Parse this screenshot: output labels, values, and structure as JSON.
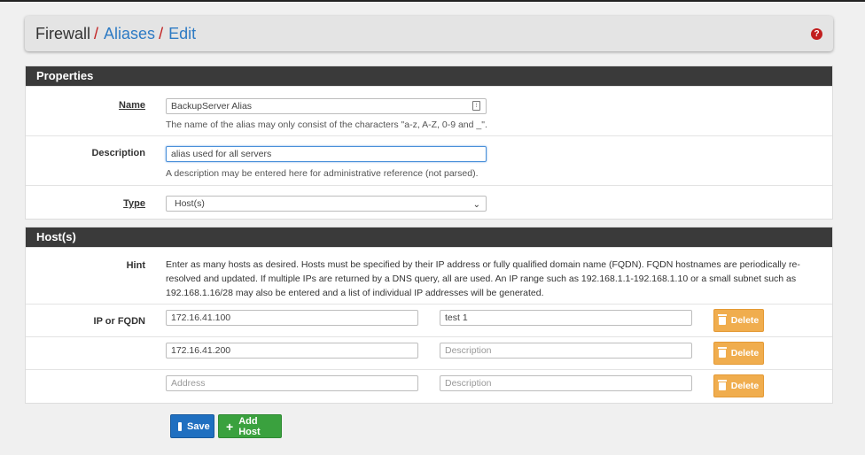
{
  "breadcrumb": {
    "root": "Firewall",
    "sep": "/",
    "aliases": "Aliases",
    "edit": "Edit"
  },
  "help_icon": "question-circle-icon",
  "properties": {
    "title": "Properties",
    "name": {
      "label": "Name",
      "value": "BackupServer Alias",
      "help": "The name of the alias may only consist of the characters \"a-z, A-Z, 0-9 and _\"."
    },
    "description": {
      "label": "Description",
      "value": "alias used for all servers",
      "help": "A description may be entered here for administrative reference (not parsed)."
    },
    "type": {
      "label": "Type",
      "value": "Host(s)"
    }
  },
  "hosts": {
    "title": "Host(s)",
    "hint_label": "Hint",
    "hint_text": "Enter as many hosts as desired. Hosts must be specified by their IP address or fully qualified domain name (FQDN). FQDN hostnames are periodically re-resolved and updated. If multiple IPs are returned by a DNS query, all are used. An IP range such as 192.168.1.1-192.168.1.10 or a small subnet such as 192.168.1.16/28 may also be entered and a list of individual IP addresses will be generated.",
    "ip_label": "IP or FQDN",
    "address_placeholder": "Address",
    "description_placeholder": "Description",
    "delete_label": "Delete",
    "rows": [
      {
        "address": "172.16.41.100",
        "description": "test 1"
      },
      {
        "address": "172.16.41.200",
        "description": ""
      },
      {
        "address": "",
        "description": ""
      }
    ]
  },
  "buttons": {
    "save": "Save",
    "add_host": "Add Host"
  },
  "colors": {
    "accent_red": "#c21f1f",
    "link_blue": "#2e7bc4",
    "delete": "#f0ad4e",
    "save": "#1f6fc0",
    "add": "#3aa13e"
  }
}
